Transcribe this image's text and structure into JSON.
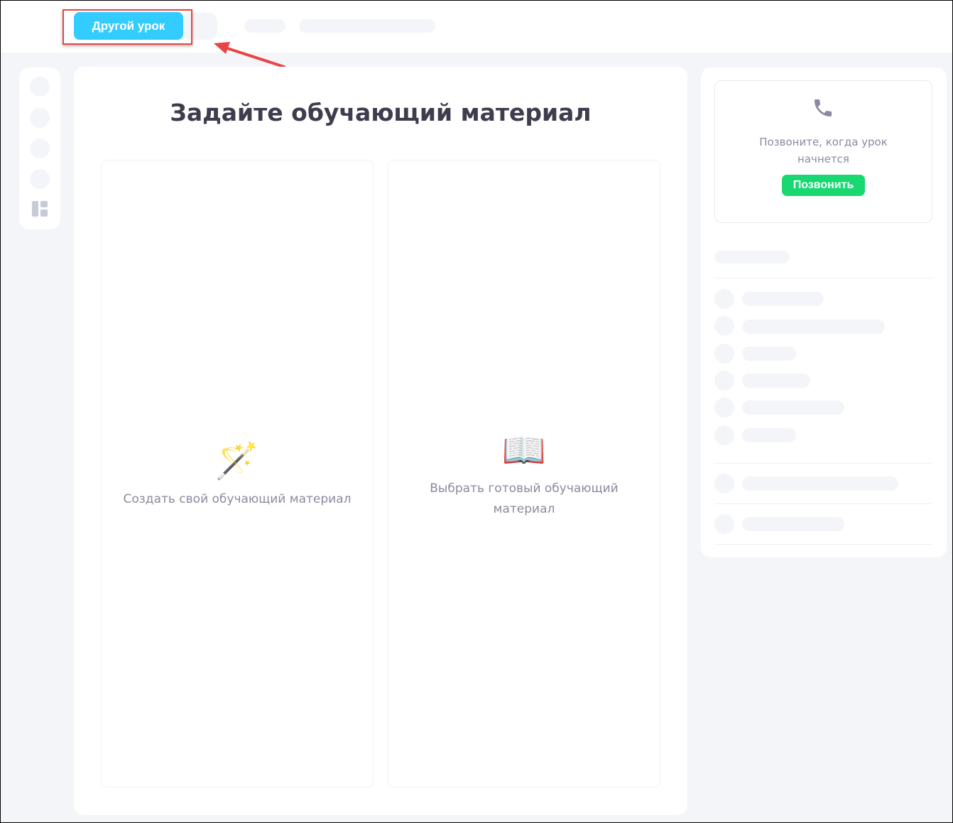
{
  "header": {
    "other_lesson_button": "Другой урок"
  },
  "main": {
    "title": "Задайте обучающий материал",
    "options": [
      {
        "icon": "magic-wand-icon",
        "emoji": "🪄",
        "label": "Создать свой обучающий материал"
      },
      {
        "icon": "open-book-icon",
        "emoji": "📖",
        "label": "Выбрать готовый обучающий материал"
      }
    ]
  },
  "call_panel": {
    "text": "Позвоните, когда урок начнется",
    "button": "Позвонить"
  },
  "colors": {
    "accent": "#33ccff",
    "call": "#19d872",
    "highlight": "#e84545"
  }
}
